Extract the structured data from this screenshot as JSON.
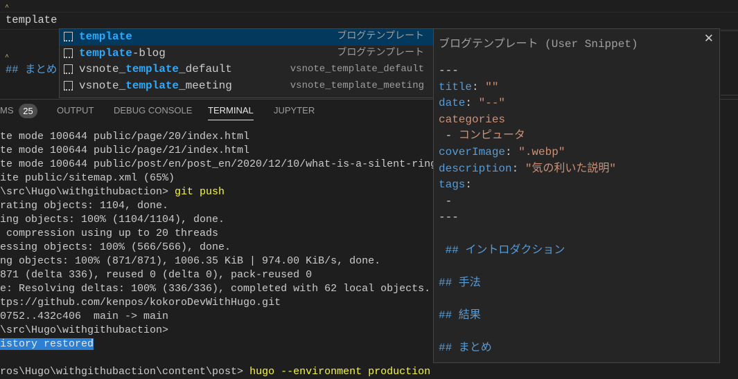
{
  "editor": {
    "current_line": "template",
    "partial_line": "## まとめ"
  },
  "panel": {
    "tabs": [
      {
        "label": "MS",
        "badge": "25"
      },
      {
        "label": "OUTPUT"
      },
      {
        "label": "DEBUG CONSOLE"
      },
      {
        "label": "TERMINAL",
        "active": true
      },
      {
        "label": "JUPYTER"
      }
    ]
  },
  "terminal": {
    "lines": [
      "te mode 100644 public/page/20/index.html",
      "te mode 100644 public/page/21/index.html",
      "te mode 100644 public/post/en/post_en/2020/12/10/what-is-a-silent-ring",
      "ite public/sitemap.xml (65%)",
      "\\src\\Hugo\\withgithubaction> ",
      "rating objects: 1104, done.",
      "ing objects: 100% (1104/1104), done.",
      " compression using up to 20 threads",
      "essing objects: 100% (566/566), done.",
      "ng objects: 100% (871/871), 1006.35 KiB | 974.00 KiB/s, done.",
      "871 (delta 336), reused 0 (delta 0), pack-reused 0",
      "e: Resolving deltas: 100% (336/336), completed with 62 local objects.",
      "tps://github.com/kenpos/kokoroDevWithHugo.git",
      "0752..432c406  main -> main",
      "\\src\\Hugo\\withgithubaction>",
      "istory restored",
      "",
      "ros\\Hugo\\withgithubaction\\content\\post> "
    ],
    "command_git": "git push",
    "command_hugo": "hugo --environment production"
  },
  "suggestions": [
    {
      "pre": "",
      "match": "template",
      "post": "",
      "detail": "ブログテンプレート",
      "selected": true
    },
    {
      "pre": "",
      "match": "template",
      "post": "-blog",
      "detail": "ブログテンプレート"
    },
    {
      "pre": "vsnote_",
      "match": "template",
      "post": "_default",
      "detail": "vsnote_template_default"
    },
    {
      "pre": "vsnote_",
      "match": "template",
      "post": "_meeting",
      "detail": "vsnote_template_meeting"
    }
  ],
  "details": {
    "title": "ブログテンプレート (User Snippet)",
    "close_icon": "close-icon",
    "lines": [
      [
        [
          "p",
          "---"
        ]
      ],
      [
        [
          "k",
          "title"
        ],
        [
          "p",
          ": "
        ],
        [
          "s",
          "\"\""
        ]
      ],
      [
        [
          "k",
          "date"
        ],
        [
          "p",
          ": "
        ],
        [
          "s",
          "\"--\""
        ]
      ],
      [
        [
          "o",
          "categories"
        ]
      ],
      [
        [
          "p",
          " - "
        ],
        [
          "o",
          "コンピュータ"
        ]
      ],
      [
        [
          "k",
          "coverImage"
        ],
        [
          "p",
          ": "
        ],
        [
          "s",
          "\".webp\""
        ]
      ],
      [
        [
          "k",
          "description"
        ],
        [
          "p",
          ": "
        ],
        [
          "s",
          "\"気の利いた説明\""
        ]
      ],
      [
        [
          "k",
          "tags"
        ],
        [
          "p",
          ":"
        ]
      ],
      [
        [
          "p",
          " -"
        ]
      ],
      [
        [
          "p",
          "---"
        ]
      ],
      [],
      [
        [
          "h",
          " ## イントロダクション"
        ]
      ],
      [],
      [
        [
          "h",
          "## 手法"
        ]
      ],
      [],
      [
        [
          "h",
          "## 結果"
        ]
      ],
      [],
      [
        [
          "h",
          "## まとめ"
        ]
      ]
    ]
  },
  "colors": {
    "key": "#569cd6",
    "string": "#ce9178",
    "match": "#2aaaff",
    "selected_row": "#04395e",
    "selection": "#2c7fd3"
  }
}
